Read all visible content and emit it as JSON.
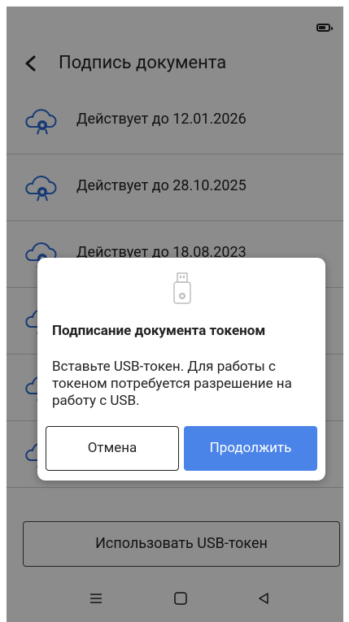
{
  "app": {
    "title": "Подпись документа"
  },
  "certificates": [
    {
      "label": "Действует до 12.01.2026"
    },
    {
      "label": "Действует до 28.10.2025"
    },
    {
      "label": "Действует до 18.08.2023"
    },
    {
      "label": ""
    },
    {
      "label": ""
    },
    {
      "label": ""
    }
  ],
  "bottom": {
    "usb_button": "Использовать USB-токен"
  },
  "dialog": {
    "title": "Подписание документа токеном",
    "text": "Вставьте USB-токен. Для работы с токеном потребуется разрешение на работу с USB.",
    "cancel": "Отмена",
    "continue": "Продолжить"
  },
  "colors": {
    "accent": "#4a84e8",
    "overlay": "rgba(0,0,0,0.45)"
  },
  "icons": {
    "back": "chevron-left-icon",
    "cert": "cloud-certificate-icon",
    "usb": "usb-token-icon",
    "battery": "battery-icon",
    "nav_menu": "menu-icon",
    "nav_home": "home-icon",
    "nav_back": "back-triangle-icon"
  }
}
